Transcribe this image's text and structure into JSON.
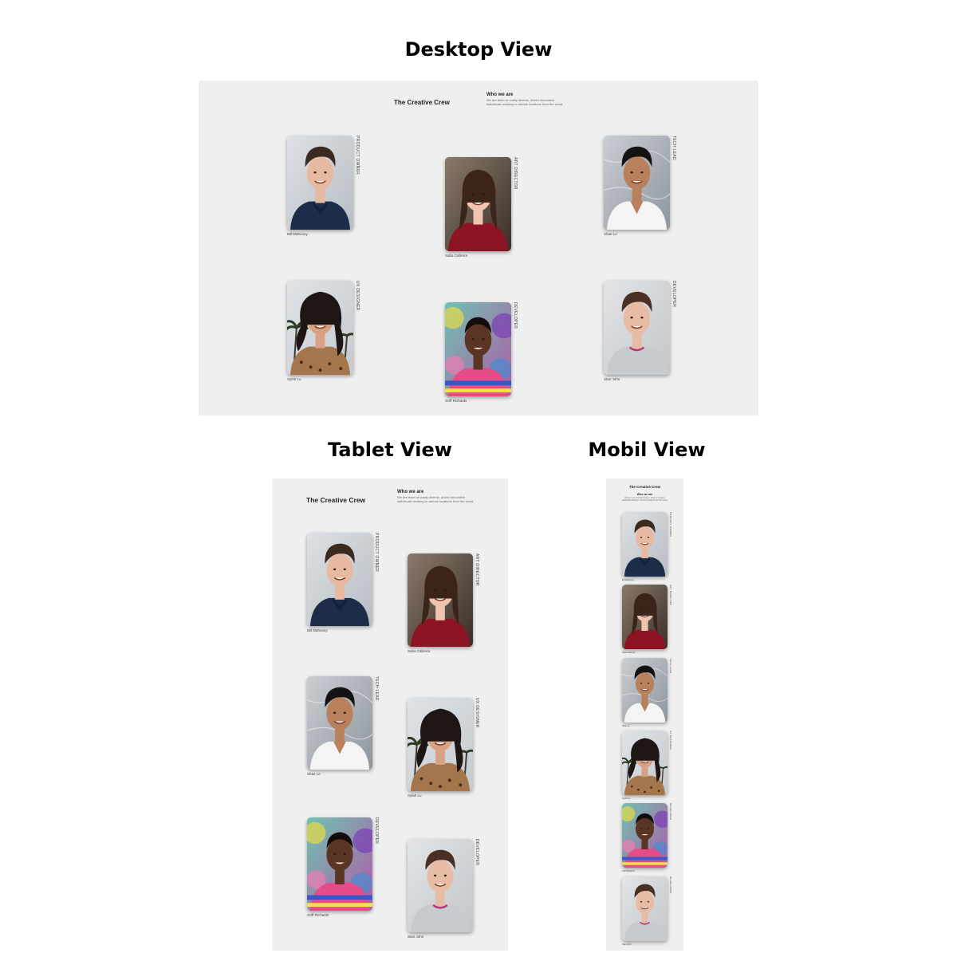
{
  "headings": {
    "desktop": "Desktop View",
    "tablet": "Tablet View",
    "mobile": "Mobil View"
  },
  "page": {
    "title": "The Creative Crew",
    "who_title": "Who we are",
    "who_text": "We are team of craiity diverse, driven innovative individuals working in various locations from the world."
  },
  "members": [
    {
      "name": "Bill Mahoney",
      "role": "Product Owner",
      "photo": "man-navy-polo-portrait"
    },
    {
      "name": "Saba Cabrera",
      "role": "Art Director",
      "photo": "woman-red-top-portrait"
    },
    {
      "name": "Shae Le",
      "role": "Tech Lead",
      "photo": "man-white-vneck-portrait"
    },
    {
      "name": "Sylah Lu",
      "role": "UX Designer",
      "photo": "woman-leopard-top-portrait"
    },
    {
      "name": "Griff Richards",
      "role": "Developer",
      "photo": "man-striped-shirt-portrait"
    },
    {
      "name": "Stan John",
      "role": "Developer",
      "photo": "man-grey-sweater-portrait"
    }
  ],
  "colors": {
    "frame_bg": "#efefef",
    "page_bg": "#ffffff",
    "text_dark": "#222222",
    "text_muted": "#666666"
  }
}
